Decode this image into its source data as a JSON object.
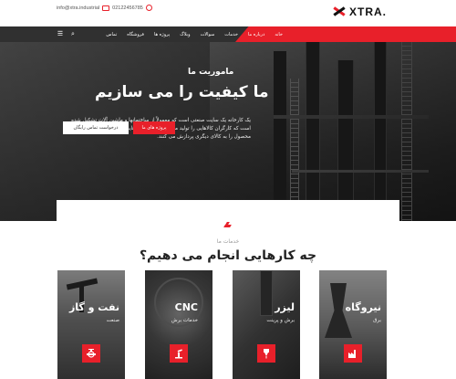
{
  "brand": {
    "logo_text": "XTRA."
  },
  "topbar": {
    "email": "info@xtra.industrial",
    "phone": "02122456785"
  },
  "nav": {
    "items": [
      "خانه",
      "درباره ما",
      "خدمات",
      "سوالات",
      "وبلاگ",
      "پروژه ها",
      "فروشگاه",
      "تماس"
    ],
    "icons": [
      "search-icon",
      "menu-icon"
    ]
  },
  "hero": {
    "subtitle": "ماموریت ما",
    "title": "ما کیفیت را می سازیم",
    "description": "یک کارخانه یک سایت صنعتی است که معمولاً از ساختمانها و ماشین آلات تشکیل شده است که کارگران کالاهایی را تولید می کنند و یا ماشین هایی را کار می کنند که یک محصول را به کالای دیگری پردازش می کنند.",
    "primary_button": "پروژه های ما",
    "secondary_button": "درخواست تماس رایگان"
  },
  "services": {
    "label": "خدمات ما",
    "title": "چه کارهایی انجام می دهیم؟",
    "cards": [
      {
        "title": "نیروگاه",
        "subtitle": "برق",
        "icon": "factory-icon"
      },
      {
        "title": "لیزر",
        "subtitle": "برش و پرینت",
        "icon": "laser-icon"
      },
      {
        "title": "CNC",
        "subtitle": "خدمات برش",
        "icon": "robot-arm-icon"
      },
      {
        "title": "نفت و گاز",
        "subtitle": "صنعت",
        "icon": "valve-icon"
      }
    ]
  },
  "colors": {
    "accent": "#e8202a",
    "dark": "#2f2f2f"
  }
}
